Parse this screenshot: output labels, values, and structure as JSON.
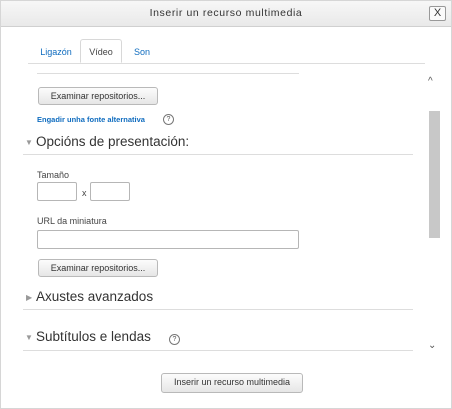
{
  "dialog": {
    "title": "Inserir un recurso multimedia",
    "close_label": "X"
  },
  "tabs": [
    {
      "label": "Ligazón",
      "active": false
    },
    {
      "label": "Vídeo",
      "active": true
    },
    {
      "label": "Son",
      "active": false
    }
  ],
  "pane": {
    "browse_button_1": "Examinar repositorios...",
    "add_alternative_link": "Engadir unha fonte alternativa",
    "help_icon_glyph": "?",
    "presentation_section": "Opcións de presentación:",
    "size_label": "Tamaño",
    "size_separator": "x",
    "width_value": "",
    "height_value": "",
    "thumbnail_label": "URL da miniatura",
    "thumbnail_value": "",
    "browse_button_2": "Examinar repositorios...",
    "advanced_section": "Axustes avanzados",
    "subtitles_section": "Subtítulos e lendas",
    "subtitles_help_glyph": "?"
  },
  "scrollbar": {
    "up_glyph": "^",
    "down_glyph": "⌄"
  },
  "footer": {
    "insert_button": "Inserir un recurso multimedia"
  }
}
